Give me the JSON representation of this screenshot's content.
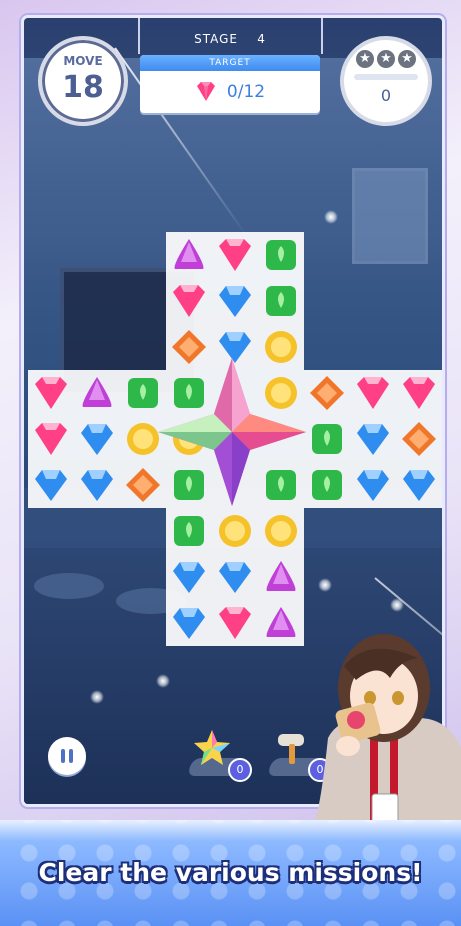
{
  "hud": {
    "move_label": "MOVE",
    "move_value": "18",
    "stage_label": "STAGE",
    "stage_number": "4",
    "target_label": "TARGET",
    "target_progress": "0/12",
    "score_value": "0",
    "stars_earned": 0,
    "stars_total": 3
  },
  "boosters": [
    {
      "icon": "rainbow-star-icon",
      "count": "0"
    },
    {
      "icon": "hammer-icon",
      "count": "0"
    }
  ],
  "board": {
    "rows": [
      [
        null,
        null,
        null,
        "purple",
        "pink",
        "green",
        null,
        null,
        null
      ],
      [
        null,
        null,
        null,
        "pink",
        "blue",
        "green",
        null,
        null,
        null
      ],
      [
        null,
        null,
        null,
        "orange",
        "blue",
        "yellow",
        null,
        null,
        null
      ],
      [
        "pink",
        "purple",
        "green",
        "green",
        "special",
        "yellow",
        "orange",
        "pink",
        "pink"
      ],
      [
        "pink",
        "blue",
        "yellow",
        "yellow",
        "special",
        "special",
        "green",
        "blue",
        "orange"
      ],
      [
        "blue",
        "blue",
        "orange",
        "green",
        "special",
        "green",
        "green",
        "blue",
        "blue"
      ],
      [
        null,
        null,
        null,
        "green",
        "yellow",
        "yellow",
        null,
        null,
        null
      ],
      [
        null,
        null,
        null,
        "blue",
        "blue",
        "purple",
        null,
        null,
        null
      ],
      [
        null,
        null,
        null,
        "blue",
        "pink",
        "purple",
        null,
        null,
        null
      ]
    ]
  },
  "colors": {
    "pink": "#ff3f86",
    "purple": "#c03fd6",
    "blue": "#2f8df0",
    "green": "#2fb84a",
    "yellow": "#f5c22a",
    "orange": "#f0762a"
  },
  "caption": "Clear the various missions!"
}
